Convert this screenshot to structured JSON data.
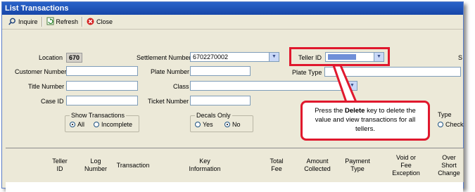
{
  "window": {
    "title": "List Transactions"
  },
  "toolbar": {
    "inquire": "Inquire",
    "refresh": "Refresh",
    "close": "Close"
  },
  "form": {
    "location_label": "Location",
    "location_value": "670",
    "settlement_label": "Settlement Number",
    "settlement_value": "6702270002",
    "teller_label": "Teller ID",
    "teller_value": "",
    "customer_label": "Customer Number",
    "plate_label": "Plate Number",
    "plate_type_label": "Plate Type",
    "title_label": "Title Number",
    "class_label": "Class",
    "case_label": "Case ID",
    "ticket_label": "Ticket Number",
    "partial_s": "S",
    "partial_type": "Type",
    "partial_check": "Check"
  },
  "show_transactions": {
    "title": "Show Transactions",
    "all": "All",
    "incomplete": "Incomplete",
    "selected": "All"
  },
  "decals_only": {
    "title": "Decals Only",
    "yes": "Yes",
    "no": "No",
    "selected": "No"
  },
  "callout": {
    "pre": "Press the ",
    "key": "Delete",
    "post": " key to delete the value and view transactions for all tellers."
  },
  "grid": {
    "columns": [
      "Teller\nID",
      "Log\nNumber",
      "Transaction",
      "Key\nInformation",
      "Total\nFee",
      "Amount\nCollected",
      "Payment\nType",
      "Void or\nFee\nException",
      "Over\nShort\nChange"
    ]
  },
  "colors": {
    "highlight": "#e0182d",
    "titlebar": "#1f55bb"
  }
}
